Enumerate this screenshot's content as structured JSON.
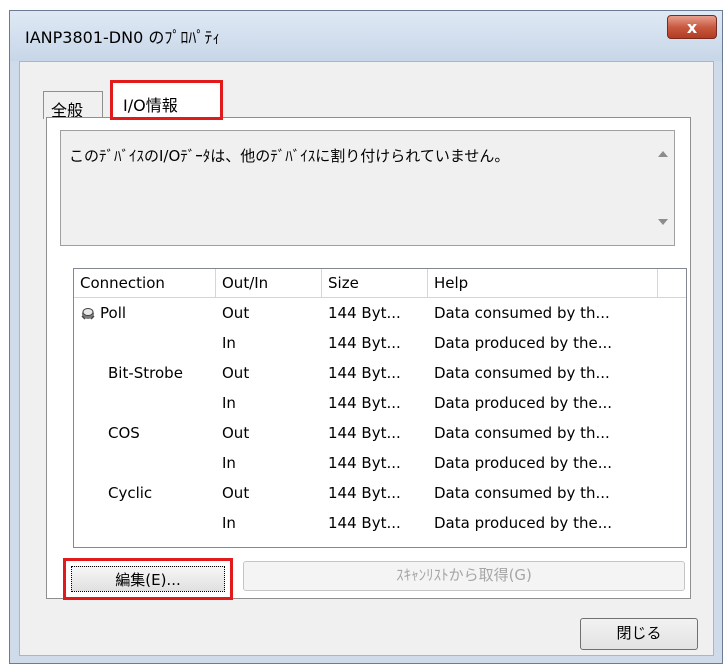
{
  "window": {
    "title": "IANP3801-DN0 のﾌﾟﾛﾊﾟﾃｨ",
    "close_symbol": "x"
  },
  "tabs": [
    {
      "label": "全般",
      "active": false
    },
    {
      "label": "I/O情報",
      "active": true
    }
  ],
  "message": {
    "text": "このﾃﾞﾊﾞｲｽのI/Oﾃﾞｰﾀは、他のﾃﾞﾊﾞｲｽに割り付けられていません。"
  },
  "table": {
    "columns": [
      "Connection",
      "Out/In",
      "Size",
      "Help",
      ""
    ],
    "rows": [
      {
        "connection": "Poll",
        "icon": "poll-icon",
        "direction": "Out",
        "size": "144 Byt...",
        "help": "Data consumed by th..."
      },
      {
        "connection": "",
        "direction": "In",
        "size": "144 Byt...",
        "help": "Data produced by the..."
      },
      {
        "connection": "Bit-Strobe",
        "direction": "Out",
        "size": "144 Byt...",
        "help": "Data consumed by th..."
      },
      {
        "connection": "",
        "direction": "In",
        "size": "144 Byt...",
        "help": "Data produced by the..."
      },
      {
        "connection": "COS",
        "direction": "Out",
        "size": "144 Byt...",
        "help": "Data consumed by th..."
      },
      {
        "connection": "",
        "direction": "In",
        "size": "144 Byt...",
        "help": "Data produced by the..."
      },
      {
        "connection": "Cyclic",
        "direction": "Out",
        "size": "144 Byt...",
        "help": "Data consumed by th..."
      },
      {
        "connection": "",
        "direction": "In",
        "size": "144 Byt...",
        "help": "Data produced by the..."
      }
    ]
  },
  "buttons": {
    "edit": "編集(E)...",
    "scan_list": "ｽｷｬﾝﾘｽﾄから取得(G)",
    "close": "閉じる"
  },
  "colors": {
    "highlight": "#e11b1b",
    "window_frame": "#cfdbe9",
    "dialog_bg": "#f0f0f0"
  }
}
